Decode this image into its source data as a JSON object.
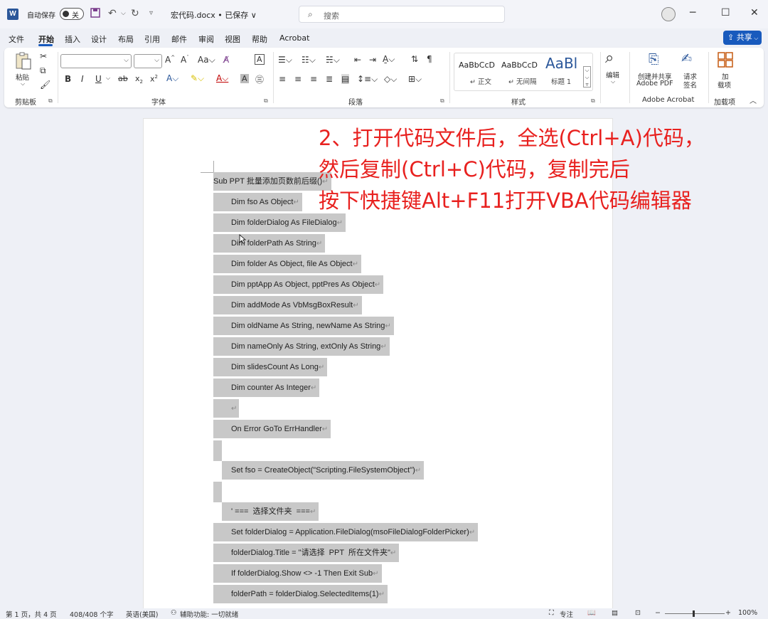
{
  "titlebar": {
    "autosave_label": "自动保存",
    "autosave_state": "关",
    "document_title": "宏代码.docx • 已保存 ∨",
    "search_placeholder": "搜索"
  },
  "tabs": [
    "文件",
    "开始",
    "插入",
    "设计",
    "布局",
    "引用",
    "邮件",
    "审阅",
    "视图",
    "帮助",
    "Acrobat"
  ],
  "share_label": "共享",
  "ribbon": {
    "clipboard": {
      "paste_label": "粘贴",
      "group_label": "剪贴板"
    },
    "font": {
      "group_label": "字体"
    },
    "paragraph": {
      "group_label": "段落"
    },
    "styles": {
      "group_label": "样式",
      "items": [
        {
          "preview": "AaBbCcD",
          "name": "↵ 正文"
        },
        {
          "preview": "AaBbCcD",
          "name": "↵ 无间隔"
        },
        {
          "preview": "AaBl",
          "name": "标题 1"
        }
      ]
    },
    "editing": {
      "label": "编辑"
    },
    "acrobat": {
      "create_share": "创建并共享",
      "adobe_pdf": "Adobe PDF",
      "request_sign_1": "请求",
      "request_sign_2": "签名",
      "group_label": "Adobe Acrobat"
    },
    "addins": {
      "label_1": "加",
      "label_2": "载项",
      "group_label": "加载项"
    }
  },
  "document": {
    "lines": [
      "Sub PPT 批量添加页数前后缀()",
      "Dim fso As Object",
      "Dim folderDialog As FileDialog",
      "Dim folderPath As String",
      "Dim folder As Object, file As Object",
      "Dim pptApp As Object, pptPres As Object",
      "Dim addMode As VbMsgBoxResult",
      "Dim oldName As String, newName As String",
      "Dim nameOnly As String, extOnly As String",
      "Dim slidesCount As Long",
      "Dim counter As Integer",
      "",
      "On Error GoTo ErrHandler",
      "",
      "Set fso = CreateObject(\"Scripting.FileSystemObject\")",
      "",
      "' ===  选择文件夹  ===",
      "Set folderDialog = Application.FileDialog(msoFileDialogFolderPicker)",
      "folderDialog.Title = \"请选择  PPT  所在文件夹\"",
      "If folderDialog.Show <> -1 Then Exit Sub",
      "folderPath = folderDialog.SelectedItems(1)"
    ],
    "overlay": {
      "line1": "2、打开代码文件后，全选(Ctrl+A)代码，",
      "line2": "然后复制(Ctrl+C)代码，复制完后",
      "line3": "按下快捷键Alt+F11打开VBA代码编辑器"
    }
  },
  "statusbar": {
    "page": "第 1 页，共 4 页",
    "words": "408/408 个字",
    "language": "英语(美国)",
    "accessibility": "辅助功能: 一切就绪",
    "focus": "专注",
    "zoom": "100%"
  }
}
